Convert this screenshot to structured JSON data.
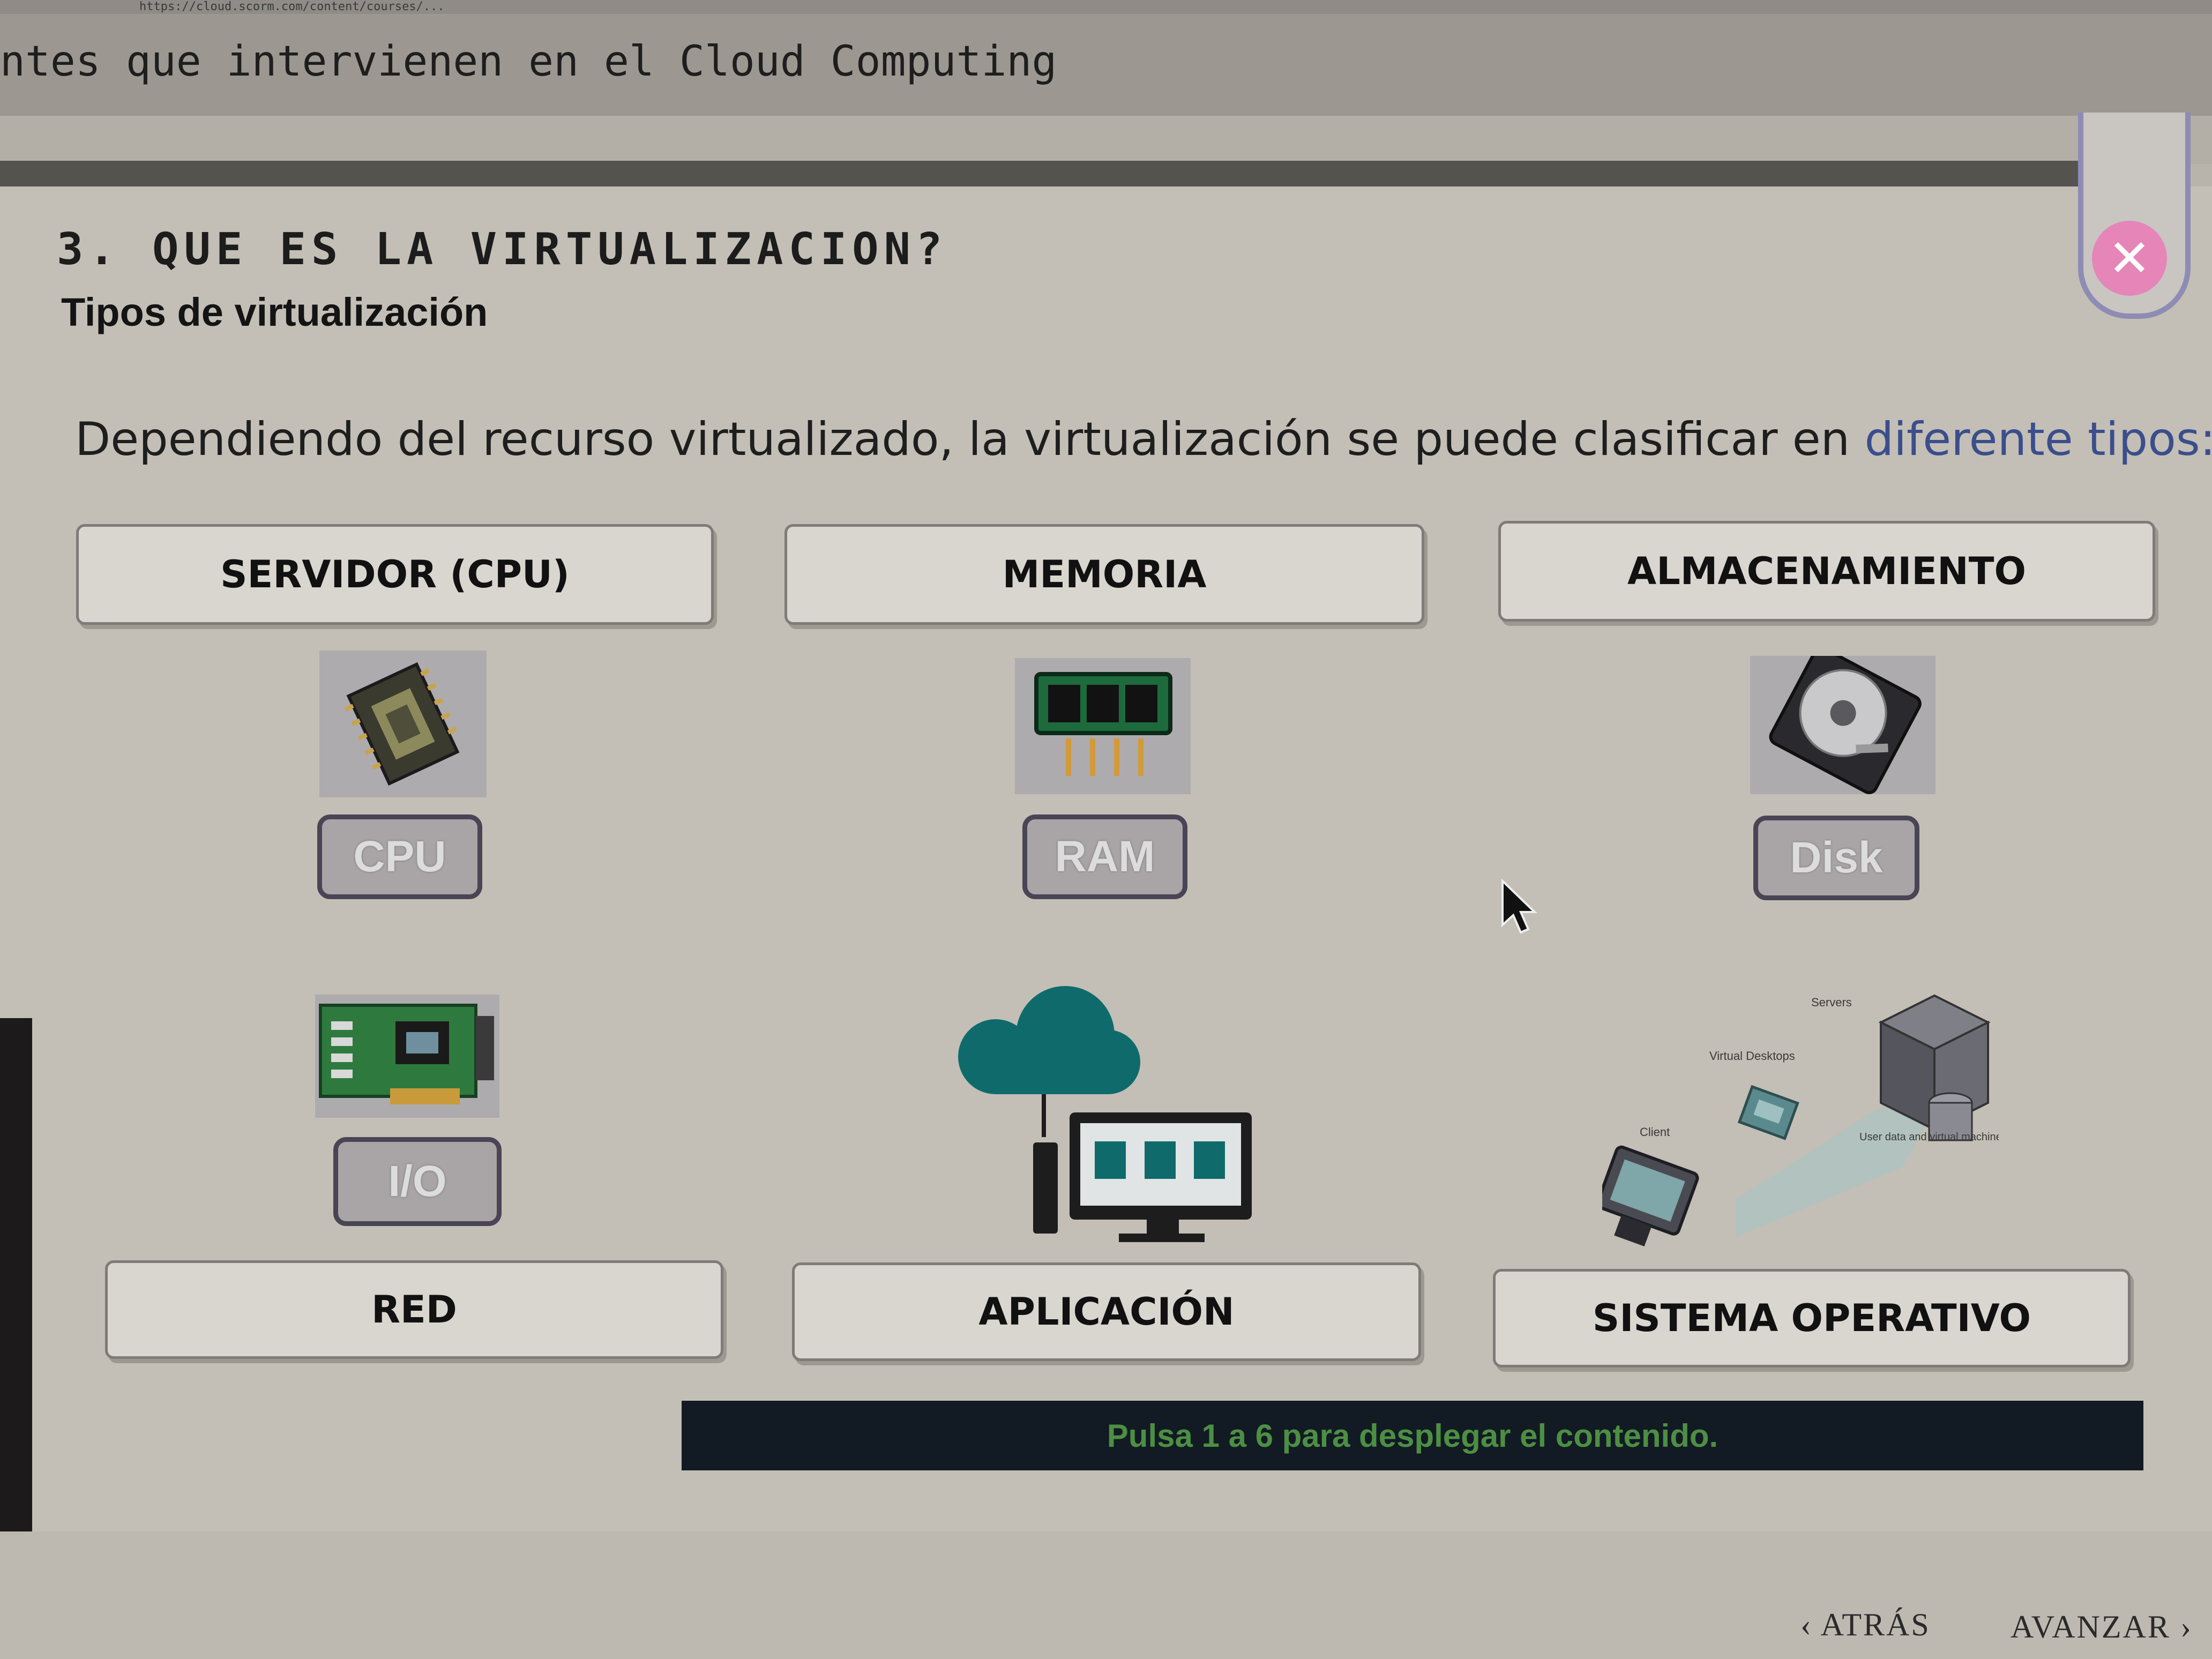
{
  "browser": {
    "url": "https://cloud.scorm.com/content/courses/..."
  },
  "header": {
    "course_title": "ntes que intervienen en el Cloud Computing"
  },
  "section": {
    "title": "3. QUE ES LA VIRTUALIZACION?",
    "subtitle": "Tipos de virtualización",
    "intro_main": "Dependiendo del recurso virtualizado, la virtualización se puede clasificar en ",
    "intro_accent": "diferente tipos:"
  },
  "categories": [
    {
      "label": "SERVIDOR (CPU)",
      "icon": "cpu-chip-icon",
      "badge": "CPU"
    },
    {
      "label": "MEMORIA",
      "icon": "ram-module-icon",
      "badge": "RAM"
    },
    {
      "label": "ALMACENAMIENTO",
      "icon": "hard-disk-icon",
      "badge": "Disk"
    },
    {
      "label": "RED",
      "icon": "network-card-icon",
      "badge": "I/O"
    },
    {
      "label": "APLICACIÓN",
      "icon": "cloud-desktop-icon"
    },
    {
      "label": "SISTEMA OPERATIVO",
      "icon": "virtual-desktop-diagram-icon"
    }
  ],
  "os_diagram": {
    "servers": "Servers",
    "virtual_desktops": "Virtual Desktops",
    "client": "Client",
    "user_data": "User data and virtual machine images"
  },
  "hint": "Pulsa 1 a 6 para desplegar el contenido.",
  "nav": {
    "back": "ATRÁS",
    "forward": "AVANZAR"
  },
  "colors": {
    "accent_text": "#3b4e8c",
    "close_button": "#e585b8",
    "hint_text": "#4c8f43",
    "hint_bar": "#121a24"
  }
}
